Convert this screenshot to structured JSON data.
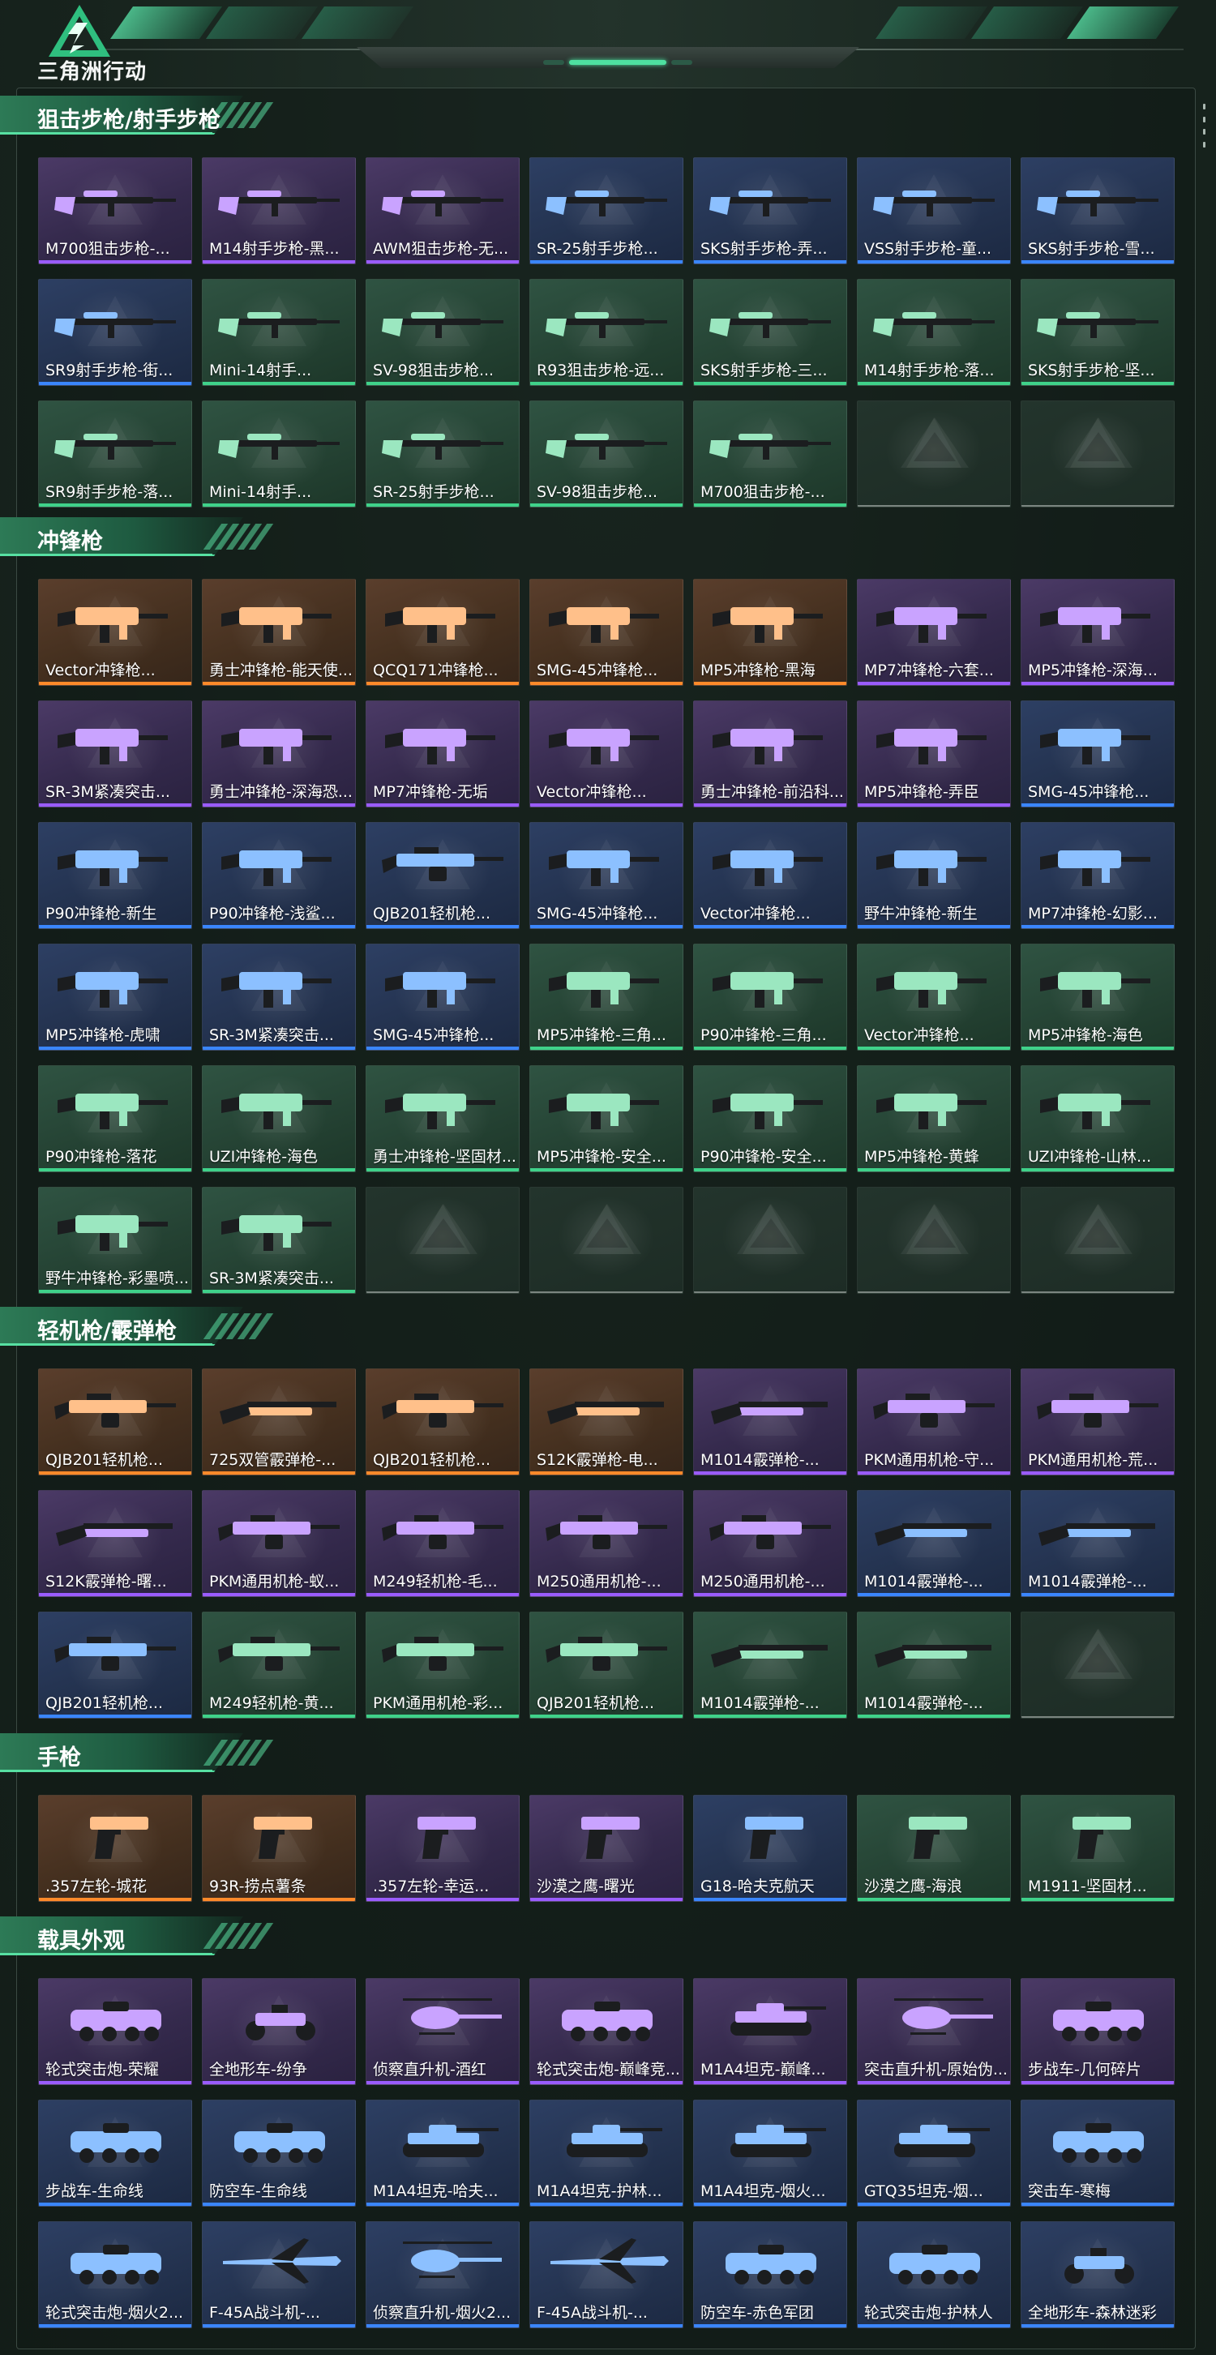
{
  "app": {
    "logo_text": "三角洲行动"
  },
  "colors": {
    "accent": "#4fd799",
    "rarity_purple": "#9a5cff",
    "rarity_blue": "#3a86ff",
    "rarity_green": "#3fd28a",
    "rarity_orange": "#ff8a2a"
  },
  "sections": [
    {
      "title": "狙击步枪/射手步枪",
      "items": [
        {
          "label": "M700狙击步枪-...",
          "rarity": "purple",
          "icon": "sniper-rifle-icon"
        },
        {
          "label": "M14射手步枪-黑...",
          "rarity": "purple",
          "icon": "marksman-rifle-icon"
        },
        {
          "label": "AWM狙击步枪-无...",
          "rarity": "purple",
          "icon": "sniper-rifle-icon"
        },
        {
          "label": "SR-25射手步枪...",
          "rarity": "blue",
          "icon": "marksman-rifle-icon"
        },
        {
          "label": "SKS射手步枪-弄...",
          "rarity": "blue",
          "icon": "marksman-rifle-icon"
        },
        {
          "label": "VSS射手步枪-童...",
          "rarity": "blue",
          "icon": "marksman-rifle-icon"
        },
        {
          "label": "SKS射手步枪-雪...",
          "rarity": "blue",
          "icon": "marksman-rifle-icon"
        },
        {
          "label": "SR9射手步枪-街...",
          "rarity": "blue",
          "icon": "marksman-rifle-icon"
        },
        {
          "label": "Mini-14射手...",
          "rarity": "green",
          "icon": "marksman-rifle-icon"
        },
        {
          "label": "SV-98狙击步枪...",
          "rarity": "green",
          "icon": "sniper-rifle-icon"
        },
        {
          "label": "R93狙击步枪-远...",
          "rarity": "green",
          "icon": "sniper-rifle-icon"
        },
        {
          "label": "SKS射手步枪-三...",
          "rarity": "green",
          "icon": "marksman-rifle-icon"
        },
        {
          "label": "M14射手步枪-落...",
          "rarity": "green",
          "icon": "marksman-rifle-icon"
        },
        {
          "label": "SKS射手步枪-坚...",
          "rarity": "green",
          "icon": "marksman-rifle-icon"
        },
        {
          "label": "SR9射手步枪-落...",
          "rarity": "green",
          "icon": "marksman-rifle-icon"
        },
        {
          "label": "Mini-14射手...",
          "rarity": "green",
          "icon": "marksman-rifle-icon"
        },
        {
          "label": "SR-25射手步枪...",
          "rarity": "green",
          "icon": "marksman-rifle-icon"
        },
        {
          "label": "SV-98狙击步枪...",
          "rarity": "green",
          "icon": "sniper-rifle-icon"
        },
        {
          "label": "M700狙击步枪-...",
          "rarity": "green",
          "icon": "sniper-rifle-icon"
        },
        {
          "label": "",
          "rarity": "empty",
          "icon": "empty-slot-icon"
        },
        {
          "label": "",
          "rarity": "empty",
          "icon": "empty-slot-icon"
        }
      ]
    },
    {
      "title": "冲锋枪",
      "items": [
        {
          "label": "Vector冲锋枪...",
          "rarity": "orange",
          "icon": "smg-icon"
        },
        {
          "label": "勇士冲锋枪-能天使...",
          "rarity": "orange",
          "icon": "smg-icon"
        },
        {
          "label": "QCQ171冲锋枪...",
          "rarity": "orange",
          "icon": "smg-icon"
        },
        {
          "label": "SMG-45冲锋枪...",
          "rarity": "orange",
          "icon": "smg-icon"
        },
        {
          "label": "MP5冲锋枪-黑海",
          "rarity": "orange",
          "icon": "smg-icon"
        },
        {
          "label": "MP7冲锋枪-六套...",
          "rarity": "purple",
          "icon": "smg-icon"
        },
        {
          "label": "MP5冲锋枪-深海...",
          "rarity": "purple",
          "icon": "smg-icon"
        },
        {
          "label": "SR-3M紧凑突击...",
          "rarity": "purple",
          "icon": "smg-icon"
        },
        {
          "label": "勇士冲锋枪-深海恐...",
          "rarity": "purple",
          "icon": "smg-icon"
        },
        {
          "label": "MP7冲锋枪-无垢",
          "rarity": "purple",
          "icon": "smg-icon"
        },
        {
          "label": "Vector冲锋枪...",
          "rarity": "purple",
          "icon": "smg-icon"
        },
        {
          "label": "勇士冲锋枪-前沿科...",
          "rarity": "purple",
          "icon": "smg-icon"
        },
        {
          "label": "MP5冲锋枪-弄臣",
          "rarity": "purple",
          "icon": "smg-icon"
        },
        {
          "label": "SMG-45冲锋枪...",
          "rarity": "blue",
          "icon": "smg-icon"
        },
        {
          "label": "P90冲锋枪-新生",
          "rarity": "blue",
          "icon": "smg-icon"
        },
        {
          "label": "P90冲锋枪-浅鲨...",
          "rarity": "blue",
          "icon": "smg-icon"
        },
        {
          "label": "QJB201轻机枪...",
          "rarity": "blue",
          "icon": "lmg-icon"
        },
        {
          "label": "SMG-45冲锋枪...",
          "rarity": "blue",
          "icon": "smg-icon"
        },
        {
          "label": "Vector冲锋枪...",
          "rarity": "blue",
          "icon": "smg-icon"
        },
        {
          "label": "野牛冲锋枪-新生",
          "rarity": "blue",
          "icon": "smg-icon"
        },
        {
          "label": "MP7冲锋枪-幻影...",
          "rarity": "blue",
          "icon": "smg-icon"
        },
        {
          "label": "MP5冲锋枪-虎啸",
          "rarity": "blue",
          "icon": "smg-icon"
        },
        {
          "label": "SR-3M紧凑突击...",
          "rarity": "blue",
          "icon": "smg-icon"
        },
        {
          "label": "SMG-45冲锋枪...",
          "rarity": "blue",
          "icon": "smg-icon"
        },
        {
          "label": "MP5冲锋枪-三角...",
          "rarity": "green",
          "icon": "smg-icon"
        },
        {
          "label": "P90冲锋枪-三角...",
          "rarity": "green",
          "icon": "smg-icon"
        },
        {
          "label": "Vector冲锋枪...",
          "rarity": "green",
          "icon": "smg-icon"
        },
        {
          "label": "MP5冲锋枪-海色",
          "rarity": "green",
          "icon": "smg-icon"
        },
        {
          "label": "P90冲锋枪-落花",
          "rarity": "green",
          "icon": "smg-icon"
        },
        {
          "label": "UZI冲锋枪-海色",
          "rarity": "green",
          "icon": "smg-icon"
        },
        {
          "label": "勇士冲锋枪-坚固材...",
          "rarity": "green",
          "icon": "smg-icon"
        },
        {
          "label": "MP5冲锋枪-安全...",
          "rarity": "green",
          "icon": "smg-icon"
        },
        {
          "label": "P90冲锋枪-安全...",
          "rarity": "green",
          "icon": "smg-icon"
        },
        {
          "label": "MP5冲锋枪-黄蜂",
          "rarity": "green",
          "icon": "smg-icon"
        },
        {
          "label": "UZI冲锋枪-山林...",
          "rarity": "green",
          "icon": "smg-icon"
        },
        {
          "label": "野牛冲锋枪-彩墨喷...",
          "rarity": "green",
          "icon": "smg-icon"
        },
        {
          "label": "SR-3M紧凑突击...",
          "rarity": "green",
          "icon": "smg-icon"
        },
        {
          "label": "",
          "rarity": "empty",
          "icon": "empty-slot-icon"
        },
        {
          "label": "",
          "rarity": "empty",
          "icon": "empty-slot-icon"
        },
        {
          "label": "",
          "rarity": "empty",
          "icon": "empty-slot-icon"
        },
        {
          "label": "",
          "rarity": "empty",
          "icon": "empty-slot-icon"
        },
        {
          "label": "",
          "rarity": "empty",
          "icon": "empty-slot-icon"
        }
      ]
    },
    {
      "title": "轻机枪/霰弹枪",
      "items": [
        {
          "label": "QJB201轻机枪...",
          "rarity": "orange",
          "icon": "lmg-icon"
        },
        {
          "label": "725双管霰弹枪-...",
          "rarity": "orange",
          "icon": "shotgun-icon"
        },
        {
          "label": "QJB201轻机枪...",
          "rarity": "orange",
          "icon": "lmg-icon"
        },
        {
          "label": "S12K霰弹枪-电...",
          "rarity": "orange",
          "icon": "shotgun-icon"
        },
        {
          "label": "M1014霰弹枪-...",
          "rarity": "purple",
          "icon": "shotgun-icon"
        },
        {
          "label": "PKM通用机枪-守...",
          "rarity": "purple",
          "icon": "lmg-icon"
        },
        {
          "label": "PKM通用机枪-荒...",
          "rarity": "purple",
          "icon": "lmg-icon"
        },
        {
          "label": "S12K霰弹枪-曙...",
          "rarity": "purple",
          "icon": "shotgun-icon"
        },
        {
          "label": "PKM通用机枪-蚁...",
          "rarity": "purple",
          "icon": "lmg-icon"
        },
        {
          "label": "M249轻机枪-毛...",
          "rarity": "purple",
          "icon": "lmg-icon"
        },
        {
          "label": "M250通用机枪-...",
          "rarity": "purple",
          "icon": "lmg-icon"
        },
        {
          "label": "M250通用机枪-...",
          "rarity": "purple",
          "icon": "lmg-icon"
        },
        {
          "label": "M1014霰弹枪-...",
          "rarity": "blue",
          "icon": "shotgun-icon"
        },
        {
          "label": "M1014霰弹枪-...",
          "rarity": "blue",
          "icon": "shotgun-icon"
        },
        {
          "label": "QJB201轻机枪...",
          "rarity": "blue",
          "icon": "lmg-icon"
        },
        {
          "label": "M249轻机枪-黄...",
          "rarity": "green",
          "icon": "lmg-icon"
        },
        {
          "label": "PKM通用机枪-彩...",
          "rarity": "green",
          "icon": "lmg-icon"
        },
        {
          "label": "QJB201轻机枪...",
          "rarity": "green",
          "icon": "lmg-icon"
        },
        {
          "label": "M1014霰弹枪-...",
          "rarity": "green",
          "icon": "shotgun-icon"
        },
        {
          "label": "M1014霰弹枪-...",
          "rarity": "green",
          "icon": "shotgun-icon"
        },
        {
          "label": "",
          "rarity": "empty",
          "icon": "empty-slot-icon"
        }
      ]
    },
    {
      "title": "手枪",
      "items": [
        {
          "label": ".357左轮-城花",
          "rarity": "orange",
          "icon": "revolver-icon"
        },
        {
          "label": "93R-捞点薯条",
          "rarity": "orange",
          "icon": "pistol-icon"
        },
        {
          "label": ".357左轮-幸运...",
          "rarity": "purple",
          "icon": "revolver-icon"
        },
        {
          "label": "沙漠之鹰-曙光",
          "rarity": "purple",
          "icon": "pistol-icon"
        },
        {
          "label": "G18-哈夫克航天",
          "rarity": "blue",
          "icon": "pistol-icon"
        },
        {
          "label": "沙漠之鹰-海浪",
          "rarity": "green",
          "icon": "pistol-icon"
        },
        {
          "label": "M1911-坚固材...",
          "rarity": "green",
          "icon": "pistol-icon"
        }
      ]
    },
    {
      "title": "载具外观",
      "items": [
        {
          "label": "轮式突击炮-荣耀",
          "rarity": "purple",
          "icon": "armored-vehicle-icon"
        },
        {
          "label": "全地形车-纷争",
          "rarity": "purple",
          "icon": "atv-icon"
        },
        {
          "label": "侦察直升机-酒红",
          "rarity": "purple",
          "icon": "helicopter-icon"
        },
        {
          "label": "轮式突击炮-巅峰竞...",
          "rarity": "purple",
          "icon": "armored-vehicle-icon"
        },
        {
          "label": "M1A4坦克-巅峰...",
          "rarity": "purple",
          "icon": "tank-icon"
        },
        {
          "label": "突击直升机-原始伪...",
          "rarity": "purple",
          "icon": "helicopter-icon"
        },
        {
          "label": "步战车-几何碎片",
          "rarity": "purple",
          "icon": "armored-vehicle-icon"
        },
        {
          "label": "步战车-生命线",
          "rarity": "blue",
          "icon": "armored-vehicle-icon"
        },
        {
          "label": "防空车-生命线",
          "rarity": "blue",
          "icon": "armored-vehicle-icon"
        },
        {
          "label": "M1A4坦克-哈夫...",
          "rarity": "blue",
          "icon": "tank-icon"
        },
        {
          "label": "M1A4坦克-护林...",
          "rarity": "blue",
          "icon": "tank-icon"
        },
        {
          "label": "M1A4坦克-烟火...",
          "rarity": "blue",
          "icon": "tank-icon"
        },
        {
          "label": "GTQ35坦克-烟...",
          "rarity": "blue",
          "icon": "tank-icon"
        },
        {
          "label": "突击车-寒梅",
          "rarity": "blue",
          "icon": "armored-vehicle-icon"
        },
        {
          "label": "轮式突击炮-烟火2...",
          "rarity": "blue",
          "icon": "armored-vehicle-icon"
        },
        {
          "label": "F-45A战斗机-...",
          "rarity": "blue",
          "icon": "fighter-jet-icon"
        },
        {
          "label": "侦察直升机-烟火2...",
          "rarity": "blue",
          "icon": "helicopter-icon"
        },
        {
          "label": "F-45A战斗机-...",
          "rarity": "blue",
          "icon": "fighter-jet-icon"
        },
        {
          "label": "防空车-赤色军团",
          "rarity": "blue",
          "icon": "armored-vehicle-icon"
        },
        {
          "label": "轮式突击炮-护林人",
          "rarity": "blue",
          "icon": "armored-vehicle-icon"
        },
        {
          "label": "全地形车-森林迷彩",
          "rarity": "blue",
          "icon": "atv-icon"
        }
      ]
    }
  ]
}
